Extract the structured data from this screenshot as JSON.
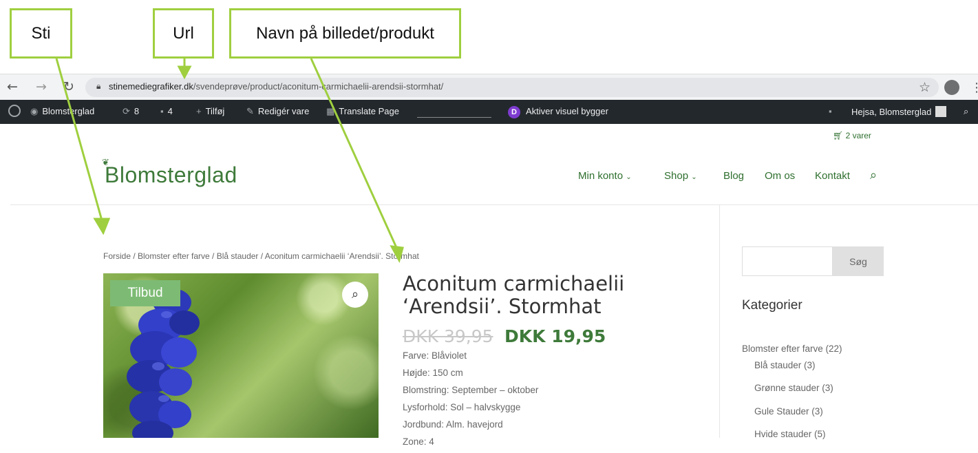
{
  "annotations": {
    "sti": "Sti",
    "url": "Url",
    "name": "Navn på billedet/produkt"
  },
  "browser": {
    "url_domain": "stinemediegrafiker.dk",
    "url_path": "/svendeprøve/product/aconitum-carmichaelii-arendsii-stormhat/"
  },
  "admin_bar": {
    "site_name": "Blomsterglad",
    "updates_count": "8",
    "comments_count": "4",
    "add_new": "Tilføj",
    "edit": "Redigér vare",
    "translate": "Translate Page",
    "visual_builder": "Aktiver visuel bygger",
    "greeting": "Hejsa, Blomsterglad"
  },
  "header": {
    "cart": "2 varer",
    "logo": "Blomsterglad",
    "nav": [
      "Min konto",
      "Shop",
      "Blog",
      "Om os",
      "Kontakt"
    ]
  },
  "product": {
    "breadcrumb": "Forside / Blomster efter farve / Blå stauder / Aconitum carmichaelii ‘Arendsii’. Stormhat",
    "sale_badge": "Tilbud",
    "title": "Aconitum carmichaelii ‘Arendsii’. Stormhat",
    "old_price": "DKK 39,95",
    "new_price": "DKK 19,95",
    "attributes": [
      "Farve: Blåviolet",
      "Højde: 150 cm",
      "Blomstring: September – oktober",
      "Lysforhold: Sol – halvskygge",
      "Jordbund: Alm. havejord",
      "Zone: 4"
    ]
  },
  "sidebar": {
    "search_button": "Søg",
    "categories_heading": "Kategorier",
    "categories": [
      "Blomster efter farve (22)",
      "Blå stauder (3)",
      "Grønne stauder (3)",
      "Gule Stauder (3)",
      "Hvide stauder (5)"
    ]
  },
  "colors": {
    "accent_green": "#3e7a3a",
    "annotation_green": "#9fcf3f",
    "admin_bar_bg": "#23282d"
  }
}
